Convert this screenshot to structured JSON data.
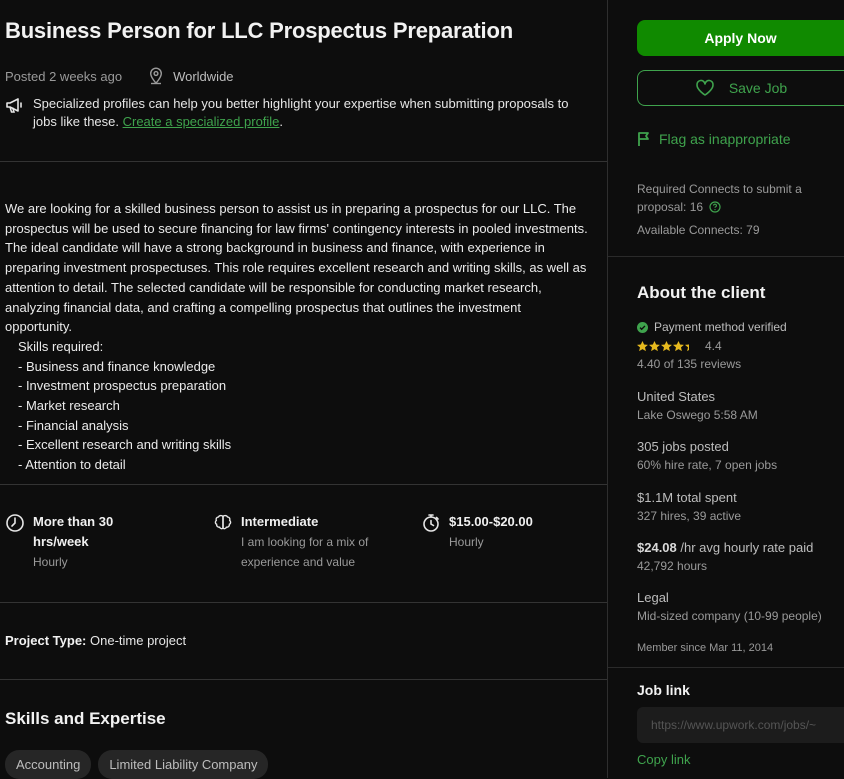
{
  "job": {
    "title": "Business Person for LLC Prospectus Preparation",
    "posted": "Posted 2 weeks ago",
    "location": "Worldwide"
  },
  "promo": {
    "text": "Specialized profiles can help you better highlight your expertise when submitting proposals to jobs like these. ",
    "link": "Create a specialized profile",
    "suffix": "."
  },
  "description": {
    "paragraph": "We are looking for a skilled business person to assist us in preparing a prospectus for our LLC. The prospectus will be used to secure financing for law firms' contingency interests in pooled investments. The ideal candidate will have a strong background in business and finance, with experience in preparing investment prospectuses. This role requires excellent research and writing skills, as well as attention to detail. The selected candidate will be responsible for conducting market research, analyzing financial data, and crafting a compelling prospectus that outlines the investment opportunity.",
    "skills_heading": "Skills required:",
    "skills": [
      "- Business and finance knowledge",
      "- Investment prospectus preparation",
      "- Market research",
      "- Financial analysis",
      "- Excellent research and writing skills",
      "- Attention to detail"
    ]
  },
  "features": [
    {
      "icon": "clock-icon",
      "title": "More than 30 hrs/week",
      "sub": "Hourly"
    },
    {
      "icon": "brain-icon",
      "title": "Intermediate",
      "sub": "I am looking for a mix of experience and value"
    },
    {
      "icon": "stopwatch-icon",
      "title": "$15.00-$20.00",
      "sub": "Hourly"
    }
  ],
  "project_type": {
    "label": "Project Type:",
    "value": " One-time project"
  },
  "skills_section": {
    "title": "Skills and Expertise",
    "chips": [
      "Accounting",
      "Limited Liability Company"
    ]
  },
  "sidebar": {
    "apply": "Apply Now",
    "save": "Save Job",
    "flag": "Flag as inappropriate",
    "connects_required": "Required Connects to submit a proposal: 16",
    "connects_available": "Available Connects: 79"
  },
  "client": {
    "title": "About the client",
    "payment": "Payment method verified",
    "rating": "4.4",
    "reviews": "4.40 of 135 reviews",
    "country": "United States",
    "city_time": "Lake Oswego 5:58 AM",
    "jobs_posted": "305 jobs posted",
    "hire_rate": "60% hire rate, 7 open jobs",
    "total_spent": "$1.1M total spent",
    "hires": "327 hires, 39 active",
    "avg_rate_value": "$24.08",
    "avg_rate_label": " /hr avg hourly rate paid",
    "hours": "42,792 hours",
    "industry": "Legal",
    "company_size": "Mid-sized company (10-99 people)",
    "member_since": "Member since Mar 11, 2014"
  },
  "job_link": {
    "title": "Job link",
    "value": "https://www.upwork.com/jobs/~",
    "copy": "Copy link"
  },
  "colors": {
    "accent": "#108a00",
    "link": "#3fa34d",
    "star": "#e6b91e",
    "background": "#0d0d0d"
  }
}
